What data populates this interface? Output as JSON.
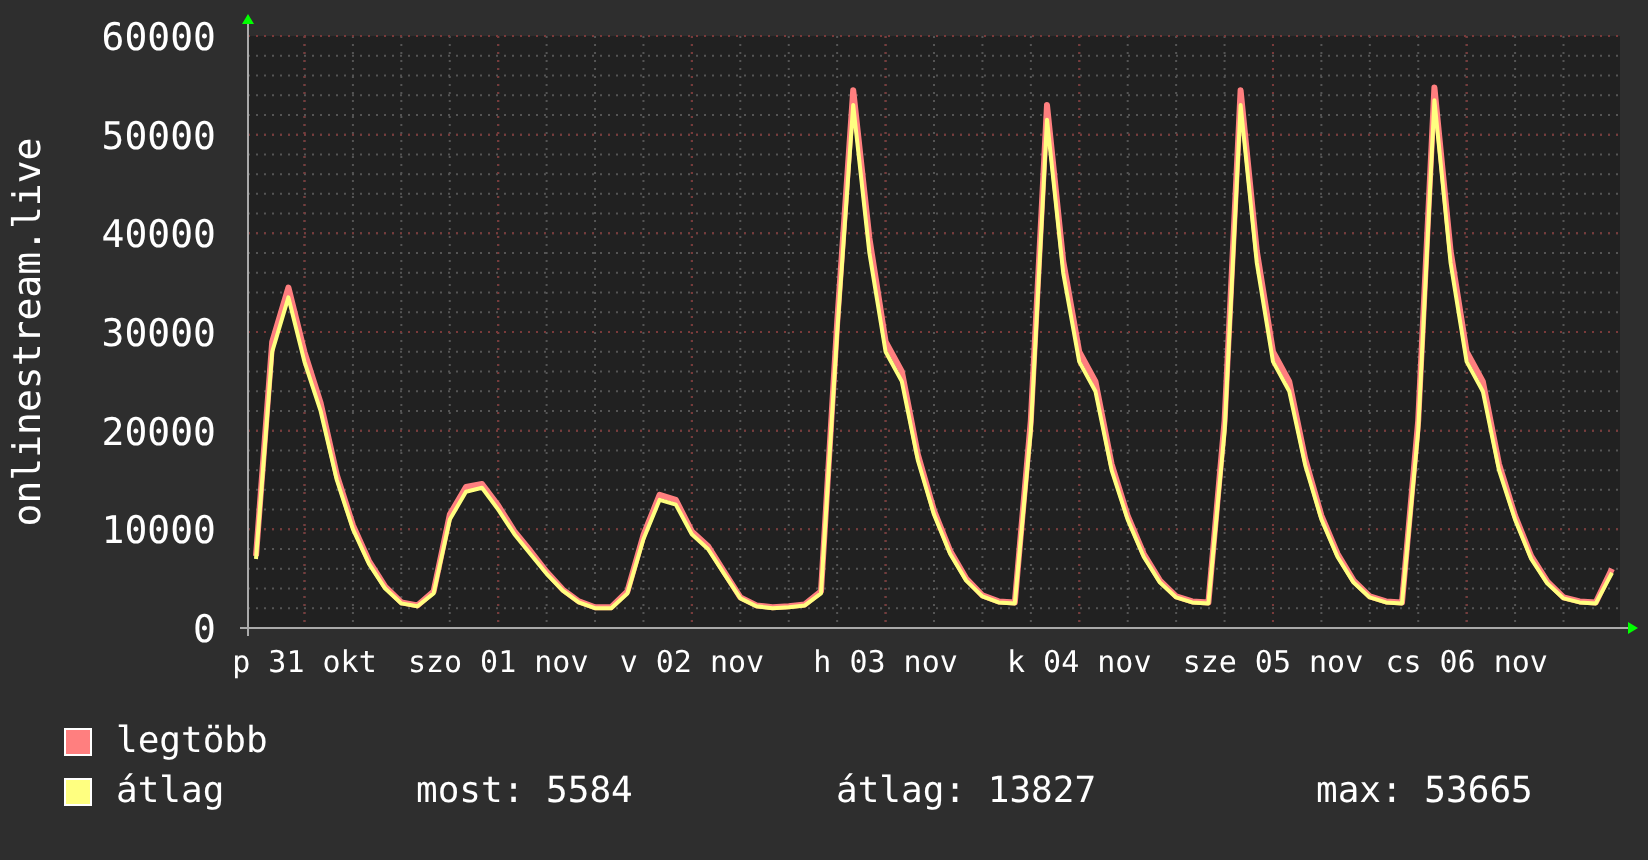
{
  "chart_data": {
    "type": "line",
    "ylabel": "onlinestream.live",
    "grid": true,
    "legend": true,
    "categories": [
      null,
      null,
      null,
      "p 31 okt",
      null,
      null,
      null,
      null,
      null,
      null,
      null,
      null,
      null,
      null,
      null,
      "szo 01 nov",
      null,
      null,
      null,
      null,
      null,
      null,
      null,
      null,
      null,
      null,
      null,
      "v 02 nov",
      null,
      null,
      null,
      null,
      null,
      null,
      null,
      null,
      null,
      null,
      null,
      "h 03 nov",
      null,
      null,
      null,
      null,
      null,
      null,
      null,
      null,
      null,
      null,
      null,
      "k 04 nov",
      null,
      null,
      null,
      null,
      null,
      null,
      null,
      null,
      null,
      null,
      null,
      "sze 05 nov",
      null,
      null,
      null,
      null,
      null,
      null,
      null,
      null,
      null,
      null,
      null,
      "cs 06 nov",
      null,
      null,
      null,
      null,
      null,
      null,
      null,
      null,
      null
    ],
    "series": [
      {
        "name": "legtöbb",
        "color": "#ff7f7f",
        "values": [
          7300,
          29000,
          34500,
          28000,
          22800,
          15500,
          10400,
          6800,
          4200,
          2600,
          2300,
          3700,
          11500,
          14300,
          14600,
          12400,
          9800,
          7800,
          5700,
          3900,
          2700,
          2100,
          2100,
          3700,
          9400,
          13500,
          13000,
          9800,
          8300,
          5700,
          3100,
          2300,
          2100,
          2200,
          2400,
          3700,
          31000,
          54500,
          39500,
          29000,
          26000,
          17600,
          11900,
          7800,
          5000,
          3300,
          2700,
          2600,
          21000,
          53000,
          37200,
          28000,
          25000,
          16600,
          11400,
          7500,
          4800,
          3200,
          2700,
          2600,
          21000,
          54500,
          38200,
          28000,
          25000,
          17100,
          11400,
          7500,
          4800,
          3200,
          2700,
          2600,
          21000,
          54800,
          38200,
          28000,
          25000,
          16600,
          11400,
          7300,
          4700,
          3100,
          2700,
          2600,
          6000
        ]
      },
      {
        "name": "átlag",
        "color": "#ffff80",
        "values": [
          7000,
          28000,
          33500,
          27000,
          22000,
          15000,
          10000,
          6500,
          4000,
          2500,
          2200,
          3500,
          11000,
          13800,
          14200,
          12000,
          9500,
          7500,
          5500,
          3800,
          2600,
          2000,
          2000,
          3500,
          9000,
          13000,
          12500,
          9500,
          8000,
          5500,
          3000,
          2200,
          2000,
          2100,
          2300,
          3500,
          30000,
          53000,
          38000,
          28000,
          25000,
          17000,
          11500,
          7500,
          4800,
          3200,
          2600,
          2500,
          20000,
          51500,
          36000,
          27000,
          24000,
          16000,
          11000,
          7200,
          4600,
          3100,
          2600,
          2500,
          20000,
          53000,
          37000,
          27000,
          24000,
          16500,
          11000,
          7200,
          4600,
          3100,
          2600,
          2500,
          20000,
          53500,
          37000,
          27000,
          24000,
          16000,
          11000,
          7000,
          4500,
          3000,
          2600,
          2500,
          5600
        ]
      }
    ],
    "ylim": [
      0,
      60000
    ],
    "yticks": [
      0,
      10000,
      20000,
      30000,
      40000,
      50000,
      60000
    ]
  },
  "stats": [
    {
      "label": "most: 5584"
    },
    {
      "label": "átlag: 13827"
    },
    {
      "label": "max: 53665"
    }
  ]
}
